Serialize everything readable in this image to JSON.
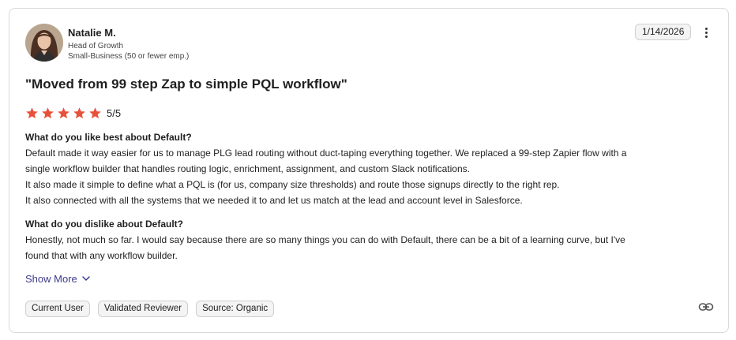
{
  "review": {
    "reviewer": {
      "name": "Natalie M.",
      "title": "Head of Growth",
      "segment": "Small-Business (50 or fewer emp.)"
    },
    "date": "1/14/2026",
    "title": "\"Moved from 99 step Zap to simple PQL workflow\"",
    "rating": {
      "value": 5,
      "max": 5,
      "label": "5/5",
      "star_color": "#e8503a"
    },
    "sections": [
      {
        "question": "What do you like best about Default?",
        "lines": [
          "Default made it way easier for us to manage PLG lead routing without duct-taping everything together. We replaced a 99-step Zapier flow with a",
          "single workflow builder that handles routing logic, enrichment, assignment, and custom Slack notifications.",
          "It also made it simple to define what a PQL is (for us, company size thresholds) and route those signups directly to the right rep.",
          "It also connected with all the systems that we needed it to and let us match at the lead and account level in Salesforce."
        ]
      },
      {
        "question": "What do you dislike about Default?",
        "lines": [
          "Honestly, not much so far. I would say because there are so many things you can do with Default, there can be a bit of a learning curve, but I've",
          "found that with any workflow builder."
        ]
      }
    ],
    "show_more_label": "Show More",
    "tags": [
      "Current User",
      "Validated Reviewer",
      "Source: Organic"
    ],
    "icons": {
      "menu": "more-vertical-icon",
      "expand": "chevron-down-icon",
      "share": "link-icon",
      "rating": "star-icon"
    },
    "accent_color": "#3d3a8c"
  }
}
